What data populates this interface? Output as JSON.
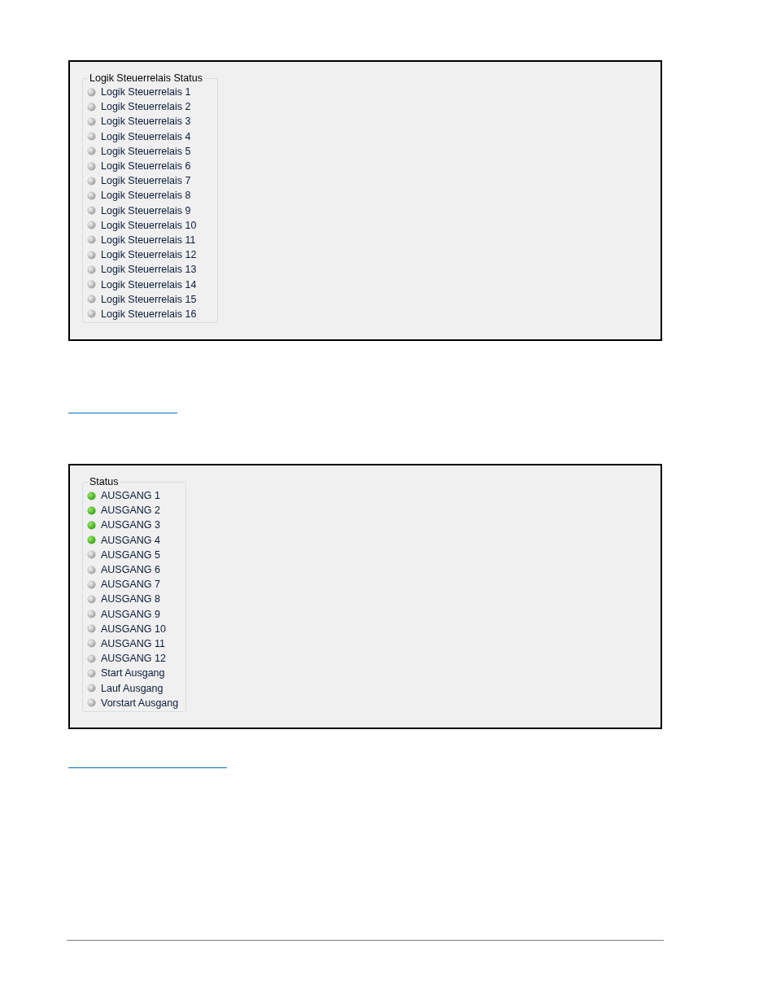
{
  "panels": [
    {
      "title": "Logik Steuerrelais Status",
      "items": [
        {
          "label": "Logik Steuerrelais 1",
          "on": false
        },
        {
          "label": "Logik Steuerrelais 2",
          "on": false
        },
        {
          "label": "Logik Steuerrelais 3",
          "on": false
        },
        {
          "label": "Logik Steuerrelais 4",
          "on": false
        },
        {
          "label": "Logik Steuerrelais 5",
          "on": false
        },
        {
          "label": "Logik Steuerrelais 6",
          "on": false
        },
        {
          "label": "Logik Steuerrelais 7",
          "on": false
        },
        {
          "label": "Logik Steuerrelais 8",
          "on": false
        },
        {
          "label": "Logik Steuerrelais 9",
          "on": false
        },
        {
          "label": "Logik Steuerrelais 10",
          "on": false
        },
        {
          "label": "Logik Steuerrelais 11",
          "on": false
        },
        {
          "label": "Logik Steuerrelais 12",
          "on": false
        },
        {
          "label": "Logik Steuerrelais 13",
          "on": false
        },
        {
          "label": "Logik Steuerrelais 14",
          "on": false
        },
        {
          "label": "Logik Steuerrelais 15",
          "on": false
        },
        {
          "label": "Logik Steuerrelais 16",
          "on": false
        }
      ]
    },
    {
      "title": "Status",
      "items": [
        {
          "label": "AUSGANG 1",
          "on": true
        },
        {
          "label": "AUSGANG 2",
          "on": true
        },
        {
          "label": "AUSGANG 3",
          "on": true
        },
        {
          "label": "AUSGANG 4",
          "on": true
        },
        {
          "label": "AUSGANG 5",
          "on": false
        },
        {
          "label": "AUSGANG 6",
          "on": false
        },
        {
          "label": "AUSGANG 7",
          "on": false
        },
        {
          "label": "AUSGANG 8",
          "on": false
        },
        {
          "label": "AUSGANG 9",
          "on": false
        },
        {
          "label": "AUSGANG 10",
          "on": false
        },
        {
          "label": "AUSGANG 11",
          "on": false
        },
        {
          "label": "AUSGANG 12",
          "on": false
        },
        {
          "label": "Start Ausgang",
          "on": false
        },
        {
          "label": "Lauf Ausgang",
          "on": false
        },
        {
          "label": "Vorstart Ausgang",
          "on": false
        }
      ]
    }
  ]
}
